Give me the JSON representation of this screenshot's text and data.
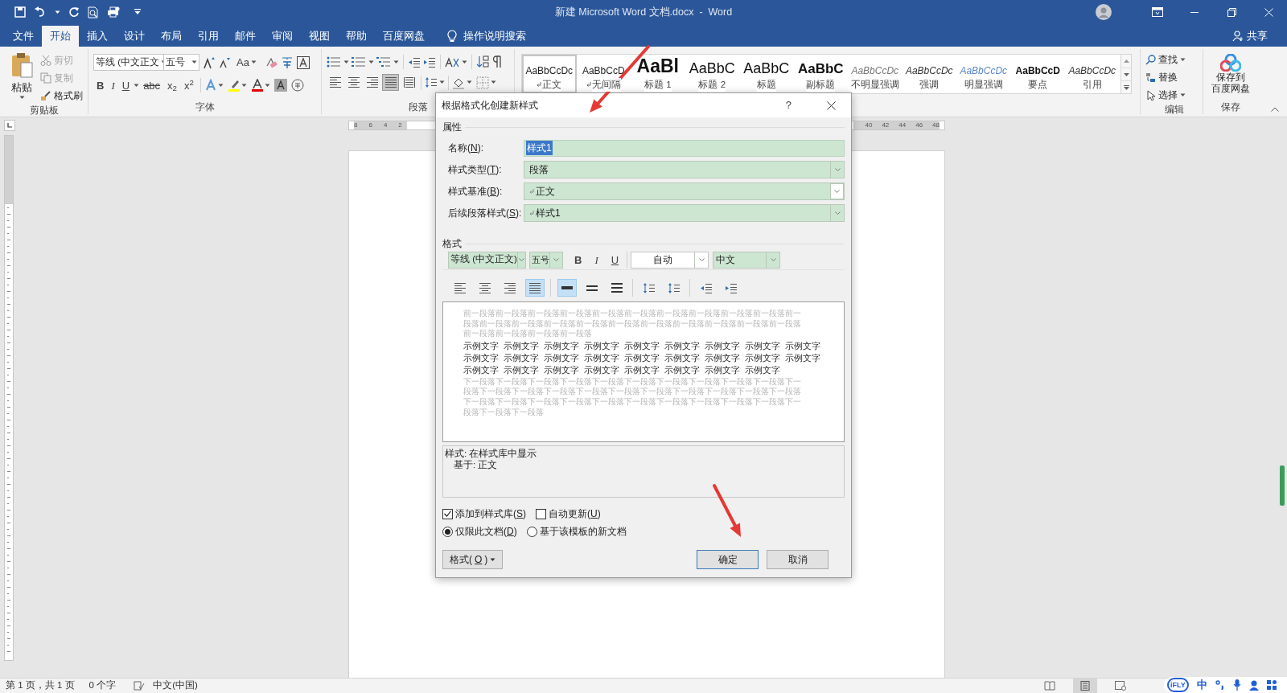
{
  "window": {
    "title": "新建 Microsoft Word 文档.docx  -  Word"
  },
  "ribbon_tabs": [
    {
      "label": "文件",
      "selected": false
    },
    {
      "label": "开始",
      "selected": true
    },
    {
      "label": "插入",
      "selected": false
    },
    {
      "label": "设计",
      "selected": false
    },
    {
      "label": "布局",
      "selected": false
    },
    {
      "label": "引用",
      "selected": false
    },
    {
      "label": "邮件",
      "selected": false
    },
    {
      "label": "审阅",
      "selected": false
    },
    {
      "label": "视图",
      "selected": false
    },
    {
      "label": "帮助",
      "selected": false
    },
    {
      "label": "百度网盘",
      "selected": false
    }
  ],
  "tell_me": "操作说明搜索",
  "share": "共享",
  "clipboard": {
    "paste": "粘贴",
    "cut": {
      "label": "剪切",
      "disabled": true
    },
    "copy": {
      "label": "复制",
      "disabled": true
    },
    "format_painter": "格式刷",
    "group_label": "剪贴板"
  },
  "font_group": {
    "font_name": "等线 (中文正文",
    "font_size": "五号",
    "case_button": "Aa",
    "group_label": "字体",
    "format_buttons": [
      {
        "kind": "bold",
        "label": "B"
      },
      {
        "kind": "italic",
        "label": "I"
      },
      {
        "kind": "underline",
        "label": "U"
      },
      {
        "kind": "strike",
        "label": "abc"
      },
      {
        "kind": "plain",
        "label": "x$_{2}$"
      },
      {
        "kind": "plain",
        "label": "x$^{2}$"
      }
    ]
  },
  "paragraph_group": {
    "group_label": "段落",
    "align_buttons": [
      {
        "kind": "align_left",
        "selected": false
      },
      {
        "kind": "align_center",
        "selected": false
      },
      {
        "kind": "align_right",
        "selected": false
      },
      {
        "kind": "justify",
        "selected": true
      },
      {
        "kind": "distributed",
        "selected": false
      }
    ]
  },
  "styles": [
    {
      "sample": "AaBbCcDc",
      "label": "正文",
      "kind": "normal",
      "paragraph_mark": true,
      "selected": true
    },
    {
      "sample": "AaBbCcD",
      "label": "无间隔",
      "kind": "normal",
      "paragraph_mark": true,
      "selected": false
    },
    {
      "sample": "AaBl",
      "label": "标题 1",
      "kind": "heading1",
      "paragraph_mark": false,
      "selected": false
    },
    {
      "sample": "AaBbC",
      "label": "标题 2",
      "kind": "heading2",
      "paragraph_mark": false,
      "selected": false
    },
    {
      "sample": "AaBbC",
      "label": "标题",
      "kind": "title",
      "paragraph_mark": false,
      "selected": false
    },
    {
      "sample": "AaBbC",
      "label": "副标题",
      "kind": "subtitle",
      "paragraph_mark": false,
      "selected": false
    },
    {
      "sample": "AaBbCcDc",
      "label": "不明显强调",
      "kind": "subtle",
      "paragraph_mark": false,
      "selected": false
    },
    {
      "sample": "AaBbCcDc",
      "label": "强调",
      "kind": "emphasis",
      "paragraph_mark": false,
      "selected": false
    },
    {
      "sample": "AaBbCcDc",
      "label": "明显强调",
      "kind": "intense",
      "paragraph_mark": false,
      "selected": false
    },
    {
      "sample": "AaBbCcD",
      "label": "要点",
      "kind": "strong",
      "paragraph_mark": false,
      "selected": false
    },
    {
      "sample": "AaBbCcDc",
      "label": "引用",
      "kind": "emphasis",
      "paragraph_mark": false,
      "selected": false
    }
  ],
  "editing": {
    "find": "查找",
    "replace": "替换",
    "select": "选择",
    "group_label": "编辑"
  },
  "save_group": {
    "button_lines": [
      "保存到",
      "百度网盘"
    ],
    "group_label": "保存"
  },
  "ruler": {
    "left_numbers": [
      "8",
      "6",
      "4",
      "2"
    ],
    "right_numbers": [
      "40",
      "42",
      "44",
      "46",
      "48"
    ]
  },
  "dialog": {
    "title": "根据格式化创建新样式",
    "help": "?",
    "properties_heading": "属性",
    "properties": [
      {
        "label": [
          "名称(",
          "N",
          "):"
        ],
        "kind": "text",
        "value": "样式1",
        "value_selected": true
      },
      {
        "label": [
          "样式类型(",
          "T",
          "):"
        ],
        "kind": "dropdown",
        "value": "段落",
        "paragraph_mark": false,
        "focused": false
      },
      {
        "label": [
          "样式基准(",
          "B",
          "):"
        ],
        "kind": "dropdown",
        "value": "正文",
        "paragraph_mark": true,
        "focused": true
      },
      {
        "label": [
          "后续段落样式(",
          "S",
          "):"
        ],
        "kind": "dropdown",
        "value": "样式1",
        "paragraph_mark": true,
        "focused": false
      }
    ],
    "format_heading": "格式",
    "font": "等线 (中文正文)",
    "size": "五号",
    "font_buttons": [
      {
        "kind": "bold",
        "label": "B"
      },
      {
        "kind": "italic",
        "label": "I"
      },
      {
        "kind": "underline",
        "label": "U"
      }
    ],
    "font_color": "自动",
    "script": "中文",
    "paragraph_buttons": [
      {
        "kind": "align_left",
        "selected": false
      },
      {
        "kind": "align_center",
        "selected": false
      },
      {
        "kind": "align_right",
        "selected": false
      },
      {
        "kind": "justify",
        "selected": true
      },
      {
        "kind": "single_spacing",
        "selected": true
      },
      {
        "kind": "one_half_spacing",
        "selected": false
      },
      {
        "kind": "double_spacing",
        "selected": false
      },
      {
        "kind": "increase_spacing",
        "selected": false
      },
      {
        "kind": "decrease_spacing",
        "selected": false
      },
      {
        "kind": "decrease_indent",
        "selected": false
      },
      {
        "kind": "increase_indent",
        "selected": false
      }
    ],
    "preview": {
      "previous": "前一段落前一段落前一段落前一段落前一段落前一段落前一段落前一段落前一段落前一段落前一段落前一段落前一段落前一段落前一段落前一段落前一段落前一段落前一段落前一段落前一段落前一段落前一段落前一段落前一段落",
      "sample_lines": [
        "示例文字 示例文字 示例文字 示例文字 示例文字 示例文字 示例文字 示例文字 示例文字",
        "示例文字 示例文字 示例文字 示例文字 示例文字 示例文字 示例文字 示例文字 示例文字",
        "示例文字 示例文字 示例文字 示例文字 示例文字 示例文字 示例文字 示例文字"
      ],
      "next": "下一段落下一段落下一段落下一段落下一段落下一段落下一段落下一段落下一段落下一段落下一段落下一段落下一段落下一段落下一段落下一段落下一段落下一段落下一段落下一段落下一段落下一段落下一段落下一段落下一段落下一段落下一段落下一段落下一段落下一段落下一段落下一段落下一段落下一段落"
    },
    "description": [
      "样式: 在样式库中显示",
      "基于: 正文"
    ],
    "options": [
      {
        "label": [
          "添加到样式库(",
          "S",
          ")"
        ],
        "checked": true
      },
      {
        "label": [
          "自动更新(",
          "U",
          ")"
        ],
        "checked": false
      }
    ],
    "scope": [
      {
        "label": [
          "仅限此文档(",
          "D",
          ")"
        ],
        "selected": true
      },
      {
        "label": [
          "基于该模板的新文档"
        ],
        "selected": false
      }
    ],
    "buttons": [
      {
        "kind": "menu",
        "label": [
          "格式(",
          "O",
          ")"
        ]
      },
      {
        "kind": "default",
        "label": [
          "确定"
        ]
      },
      {
        "kind": "normal",
        "label": [
          "取消"
        ]
      }
    ]
  },
  "status_bar": {
    "page": "第 1 页，共 1 页",
    "words": "0 个字",
    "language": "中文(中国)"
  },
  "ime_bar": {
    "logo": "iFLY",
    "mode": "中"
  }
}
